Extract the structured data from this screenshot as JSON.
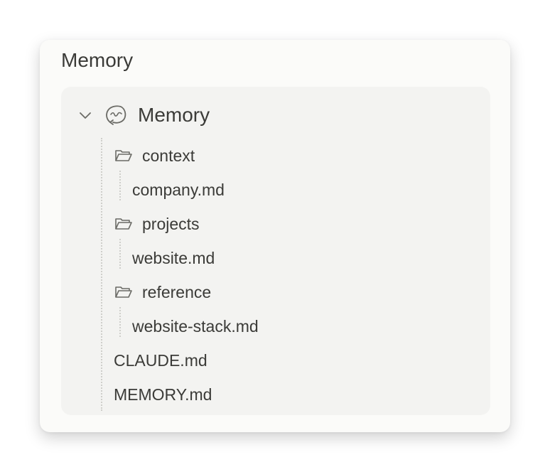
{
  "card": {
    "title": "Memory"
  },
  "tree": {
    "root": {
      "label": "Memory",
      "icon": "memory-icon",
      "expanded": true
    },
    "folders": [
      {
        "label": "context",
        "icon": "folder-open-icon",
        "files": [
          "company.md"
        ]
      },
      {
        "label": "projects",
        "icon": "folder-open-icon",
        "files": [
          "website.md"
        ]
      },
      {
        "label": "reference",
        "icon": "folder-open-icon",
        "files": [
          "website-stack.md"
        ]
      }
    ],
    "files": [
      "CLAUDE.md",
      "MEMORY.md"
    ]
  },
  "colors": {
    "card_background": "#fbfbf9",
    "panel_background": "#f3f3f1",
    "text": "#3b3b38",
    "icon": "#6b6b66",
    "guide": "#cfcfcb"
  }
}
